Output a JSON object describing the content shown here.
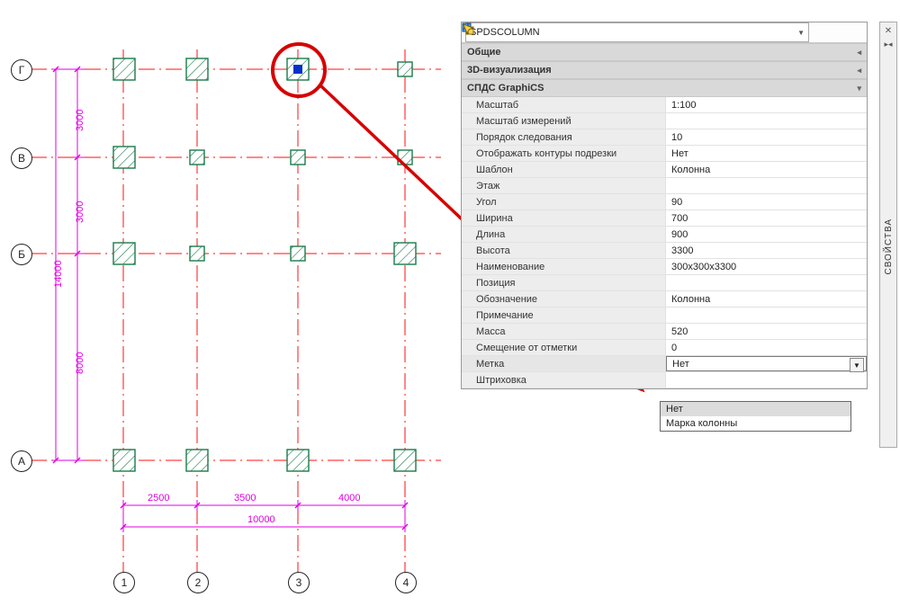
{
  "objtype": "SPDSCOLUMN",
  "rail": {
    "label": "СВОЙСТВА"
  },
  "groups": {
    "g1": "Общие",
    "g2": "3D-визуализация",
    "g3": "СПДС GraphiCS"
  },
  "props": {
    "scale": {
      "l": "Масштаб",
      "v": "1:100"
    },
    "mscale": {
      "l": "Масштаб измерений",
      "v": ""
    },
    "order": {
      "l": "Порядок следования",
      "v": "10"
    },
    "clip": {
      "l": "Отображать контуры подрезки",
      "v": "Нет"
    },
    "tmpl": {
      "l": "Шаблон",
      "v": "Колонна"
    },
    "floor": {
      "l": "Этаж",
      "v": ""
    },
    "ang": {
      "l": "Угол",
      "v": "90"
    },
    "wid": {
      "l": "Ширина",
      "v": "700"
    },
    "len": {
      "l": "Длина",
      "v": "900"
    },
    "h": {
      "l": "Высота",
      "v": "3300"
    },
    "name": {
      "l": "Наименование",
      "v": "300x300x3300"
    },
    "pos": {
      "l": "Позиция",
      "v": ""
    },
    "desig": {
      "l": "Обозначение",
      "v": "Колонна"
    },
    "note": {
      "l": "Примечание",
      "v": ""
    },
    "mass": {
      "l": "Масса",
      "v": "520"
    },
    "off": {
      "l": "Смещение от отметки",
      "v": "0"
    },
    "mark": {
      "l": "Метка",
      "v": "Нет"
    },
    "hatch": {
      "l": "Штриховка",
      "v": ""
    }
  },
  "dropdown": {
    "o1": "Нет",
    "o2": "Марка колонны"
  },
  "axes": {
    "row": {
      "g": "Г",
      "v": "В",
      "b": "Б",
      "a": "А"
    },
    "col": {
      "c1": "1",
      "c2": "2",
      "c3": "3",
      "c4": "4"
    }
  },
  "dims": {
    "v3000a": "3000",
    "v3000b": "3000",
    "v8000": "8000",
    "v14000": "14000",
    "h2500": "2500",
    "h3500": "3500",
    "h4000": "4000",
    "h10000": "10000"
  }
}
